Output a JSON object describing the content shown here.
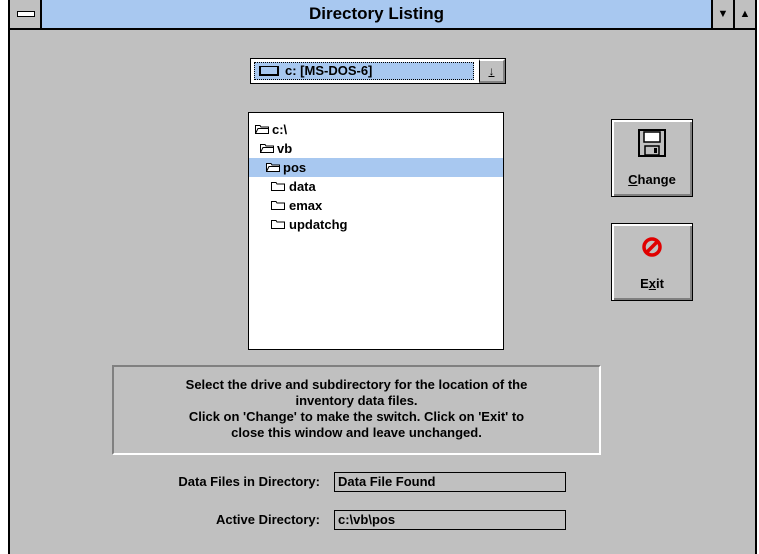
{
  "window": {
    "title": "Directory Listing",
    "minimize_glyph": "▼",
    "maximize_glyph": "▲"
  },
  "drive": {
    "selected": "c: [MS-DOS-6]",
    "arrow_glyph": "↓"
  },
  "directories": [
    {
      "name": "c:\\",
      "state": "open"
    },
    {
      "name": "vb",
      "state": "open"
    },
    {
      "name": "pos",
      "state": "open",
      "selected": true
    },
    {
      "name": "data",
      "state": "closed"
    },
    {
      "name": "emax",
      "state": "closed"
    },
    {
      "name": "updatchg",
      "state": "closed"
    }
  ],
  "buttons": {
    "change_label": "Change",
    "exit_label": "Exit",
    "change_icon": "floppy-disk-icon",
    "exit_icon": "no-sign-icon"
  },
  "instructions": {
    "line1": "Select the drive and subdirectory for the location of the",
    "line2": "inventory data files.",
    "line3": "Click on 'Change' to make the switch.  Click on 'Exit' to",
    "line4": "close this window and leave unchanged."
  },
  "fields": {
    "data_files_label": "Data Files in Directory:",
    "data_files_value": "Data File Found",
    "active_dir_label": "Active Directory:",
    "active_dir_value": "c:\\vb\\pos"
  },
  "colors": {
    "titlebar": "#a8c8f0",
    "selection": "#a8c8f0",
    "face": "#c0c0c0",
    "exit_icon": "#e00000"
  }
}
